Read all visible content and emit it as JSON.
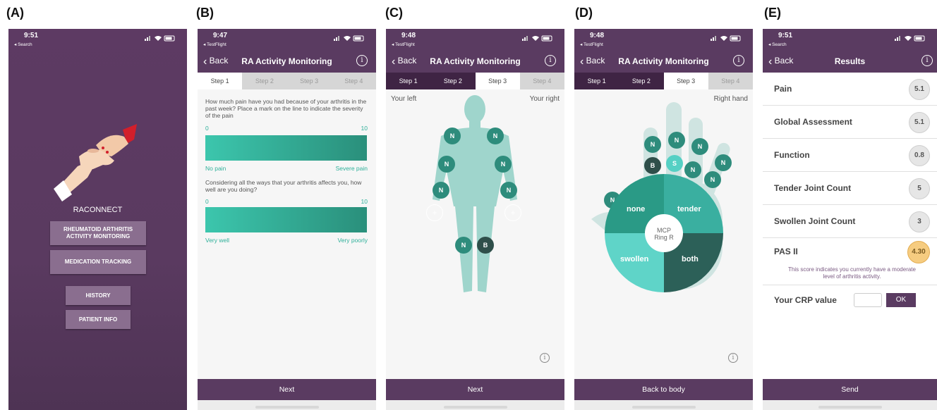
{
  "panels": {
    "a": {
      "label": "(A)",
      "status_time": "9:51",
      "status_sub": "◂ Search",
      "app_name": "RACONNECT",
      "btn_ra_line1": "RHEUMATOID ARTHRITIS",
      "btn_ra_line2": "ACTIVITY MONITORING",
      "btn_medication": "MEDICATION TRACKING",
      "btn_history": "HISTORY",
      "btn_patient_info": "PATIENT INFO"
    },
    "b": {
      "label": "(B)",
      "status_time": "9:47",
      "status_sub": "◂ TestFlight",
      "back": "Back",
      "title": "RA Activity Monitoring",
      "info": "i",
      "tabs": [
        "Step 1",
        "Step 2",
        "Step 3",
        "Step 4"
      ],
      "q1": "How much pain have you had because of your arthritis in the past week? Place a mark on the line to indicate the severity of the pain",
      "q1_min": "0",
      "q1_max": "10",
      "q1_left": "No pain",
      "q1_right": "Severe pain",
      "q2": "Considering all the ways that your arthritis affects you, how well are you doing?",
      "q2_min": "0",
      "q2_max": "10",
      "q2_left": "Very well",
      "q2_right": "Very poorly",
      "next": "Next"
    },
    "c": {
      "label": "(C)",
      "status_time": "9:48",
      "status_sub": "◂ TestFlight",
      "back": "Back",
      "title": "RA Activity Monitoring",
      "info": "i",
      "tabs": [
        "Step 1",
        "Step 2",
        "Step 3",
        "Step 4"
      ],
      "your_left": "Your left",
      "your_right": "Your right",
      "marker_n": "N",
      "marker_b": "B",
      "marker_plus": "+",
      "next": "Next"
    },
    "d": {
      "label": "(D)",
      "status_time": "9:48",
      "status_sub": "◂ TestFlight",
      "back": "Back",
      "title": "RA Activity Monitoring",
      "info": "i",
      "tabs": [
        "Step 1",
        "Step 2",
        "Step 3",
        "Step 4"
      ],
      "right_hand": "Right hand",
      "marker_n": "N",
      "marker_b": "B",
      "marker_s": "S",
      "q_none": "none",
      "q_tender": "tender",
      "q_swollen": "swollen",
      "q_both": "both",
      "center_line1": "MCP",
      "center_line2": "Ring R",
      "back_to_body": "Back to body"
    },
    "e": {
      "label": "(E)",
      "status_time": "9:51",
      "status_sub": "◂ Search",
      "back": "Back",
      "title": "Results",
      "info": "i",
      "rows": [
        {
          "label": "Pain",
          "value": "5.1"
        },
        {
          "label": "Global Assessment",
          "value": "5.1"
        },
        {
          "label": "Function",
          "value": "0.8"
        },
        {
          "label": "Tender Joint Count",
          "value": "5"
        },
        {
          "label": "Swollen Joint Count",
          "value": "3"
        },
        {
          "label": "PAS II",
          "value": "4.30"
        }
      ],
      "score_note_line1": "This score indicates you currently have a moderate",
      "score_note_line2": "level of arthritis activity.",
      "crp_label": "Your CRP value",
      "crp_value": "",
      "ok": "OK",
      "send": "Send"
    }
  },
  "colors": {
    "brand_purple": "#5a3b61",
    "tab_done": "#3f2444",
    "teal": "#2e8c7c",
    "teal_light": "#55d0c4",
    "pas_badge": "#f6cc80"
  }
}
